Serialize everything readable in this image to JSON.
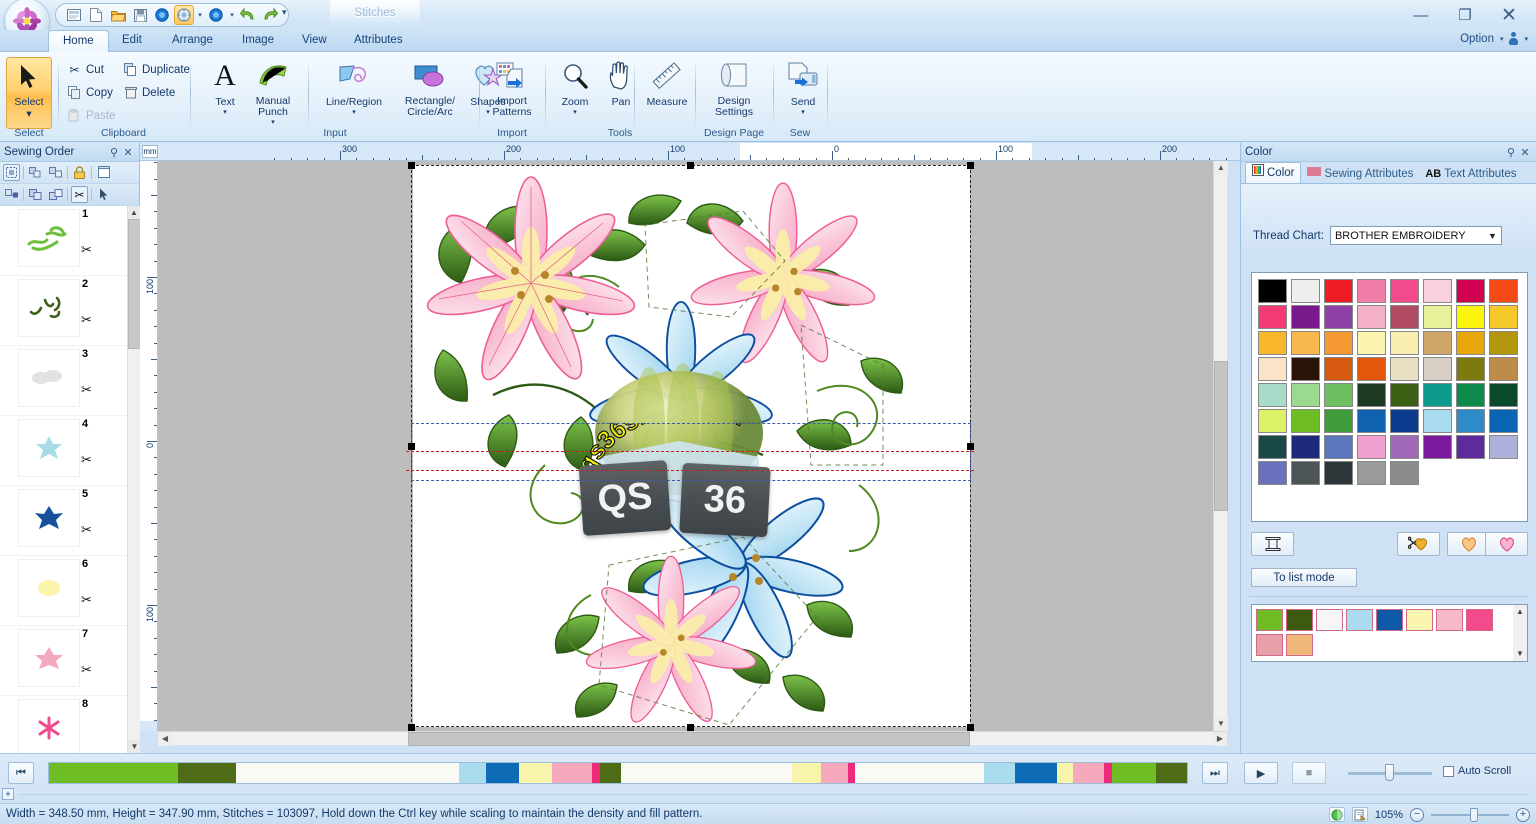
{
  "window": {
    "title": "",
    "document_tab": "Stitches",
    "minimize": "—",
    "restore": "❐",
    "close": "✕"
  },
  "quick_access": {
    "items": [
      {
        "name": "new-design-wizard",
        "glyph": "▤"
      },
      {
        "name": "new-file",
        "glyph": "⬜"
      },
      {
        "name": "open-file",
        "glyph": "📂"
      },
      {
        "name": "save-file",
        "glyph": "💾"
      },
      {
        "name": "blue-circle-tool",
        "glyph": "●"
      },
      {
        "name": "design-settings-tool",
        "glyph": "⚙"
      },
      {
        "name": "blue-circle-tool-2",
        "glyph": "●"
      },
      {
        "name": "undo",
        "glyph": "↶"
      },
      {
        "name": "redo",
        "glyph": "↷"
      }
    ],
    "more": "▾"
  },
  "ribbon": {
    "tabs": [
      {
        "label": "Home",
        "active": true
      },
      {
        "label": "Edit",
        "active": false
      },
      {
        "label": "Arrange",
        "active": false
      },
      {
        "label": "Image",
        "active": false
      },
      {
        "label": "View",
        "active": false
      },
      {
        "label": "Attributes",
        "active": false
      }
    ],
    "option_label": "Option",
    "groups": [
      {
        "name": "select",
        "label": "Select",
        "main_button": {
          "label": "Select",
          "icon": "cursor-arrow-icon"
        }
      },
      {
        "name": "clipboard",
        "label": "Clipboard",
        "buttons": [
          {
            "label": "Cut",
            "icon": "scissors-icon",
            "disabled": false
          },
          {
            "label": "Duplicate",
            "icon": "duplicate-icon",
            "disabled": false
          },
          {
            "label": "Copy",
            "icon": "copy-icon",
            "disabled": false
          },
          {
            "label": "Delete",
            "icon": "trash-icon",
            "disabled": false
          },
          {
            "label": "Paste",
            "icon": "paste-icon",
            "disabled": true
          }
        ]
      },
      {
        "name": "input",
        "label": "Input",
        "buttons": [
          {
            "label": "Text",
            "icon": "text-A-icon",
            "caret": true
          },
          {
            "label": "Manual Punch",
            "icon": "manual-punch-icon",
            "caret": true
          },
          {
            "label": "Line/Region",
            "icon": "line-region-icon",
            "caret": true
          },
          {
            "label": "Rectangle/ Circle/Arc",
            "icon": "shapes-rect-circle-icon",
            "caret": true
          },
          {
            "label": "Shapes",
            "icon": "heart-star-icon",
            "caret": true
          }
        ]
      },
      {
        "name": "import",
        "label": "Import",
        "buttons": [
          {
            "label": "Import Patterns",
            "icon": "import-patterns-icon",
            "caret": true
          }
        ]
      },
      {
        "name": "tools",
        "label": "Tools",
        "buttons": [
          {
            "label": "Zoom",
            "icon": "magnifier-icon",
            "caret": true
          },
          {
            "label": "Pan",
            "icon": "hand-icon",
            "caret": false
          },
          {
            "label": "Measure",
            "icon": "ruler-icon",
            "caret": false
          }
        ]
      },
      {
        "name": "design-page",
        "label": "Design Page",
        "buttons": [
          {
            "label": "Design Settings",
            "icon": "design-settings-icon",
            "caret": false
          }
        ]
      },
      {
        "name": "sew",
        "label": "Sew",
        "buttons": [
          {
            "label": "Send",
            "icon": "send-icon",
            "caret": true
          }
        ]
      }
    ]
  },
  "sewing_order": {
    "title": "Sewing Order",
    "pin": "⚓",
    "close": "✕",
    "toolbar_row1": [
      {
        "name": "select-all-objects-icon",
        "glyph": "⛶",
        "active": true
      },
      {
        "name": "group-objects-icon",
        "glyph": "❐"
      },
      {
        "name": "ungroup-objects-icon",
        "glyph": "❑"
      },
      {
        "name": "lock-icon",
        "glyph": "🔒"
      },
      {
        "name": "design-page-icon",
        "glyph": "▢"
      }
    ],
    "toolbar_row2": [
      {
        "name": "insert-object-icon",
        "glyph": "⊞"
      },
      {
        "name": "merge-objects-icon",
        "glyph": "⧉"
      },
      {
        "name": "split-objects-icon",
        "glyph": "❐"
      },
      {
        "name": "cut-thread-icon",
        "glyph": "✂",
        "active": true
      },
      {
        "name": "pointer-icon",
        "glyph": "➤"
      }
    ],
    "items": [
      {
        "number": "1",
        "color": "#6ec03c",
        "shape": "vine"
      },
      {
        "number": "2",
        "color": "#3e5f1b",
        "shape": "vine"
      },
      {
        "number": "3",
        "color": "#e2e2e2",
        "shape": "blob"
      },
      {
        "number": "4",
        "color": "#a8dbe8",
        "shape": "star"
      },
      {
        "number": "5",
        "color": "#17509b",
        "shape": "blob"
      },
      {
        "number": "6",
        "color": "#fbf6ae",
        "shape": "blob"
      },
      {
        "number": "7",
        "color": "#f5a8bd",
        "shape": "blob"
      },
      {
        "number": "8",
        "color": "#ef4c8f",
        "shape": "star"
      }
    ],
    "scissors_glyph": "✂"
  },
  "rulers": {
    "unit": "mm",
    "top_labels": [
      "300",
      "200",
      "100",
      "0",
      "100",
      "200",
      "300"
    ],
    "left_labels": [
      "100",
      "0",
      "100"
    ]
  },
  "canvas": {
    "watermark": {
      "arc_text": "qs36shop.com",
      "box_left": "QS",
      "box_right": "36",
      "arc_color": "#f2f20a",
      "arc_outline": "#1b1b1b"
    },
    "design_colors": {
      "pink_petal": "#f8b8cd",
      "pink_outline": "#ef5f97",
      "yellow_petal": "#fbf2a8",
      "blue_petal": "#bfe3f5",
      "blue_outline": "#0d4ea0",
      "leaf_green": "#3f7a22",
      "leaf_light": "#7cc24a",
      "stem_dark": "#2d5a14"
    }
  },
  "playback": {
    "first_button": "⏮",
    "last_button": "⏭",
    "play_button": "▶",
    "stop_button": "■",
    "expand_button": "+",
    "auto_scroll_label": "Auto Scroll",
    "auto_scroll_checked": false,
    "stitch_segments": [
      {
        "color": "#6fbd25",
        "width": 12.5
      },
      {
        "color": "#4e6b15",
        "width": 5.6
      },
      {
        "color": "#fafaf5",
        "width": 21.5
      },
      {
        "color": "#a9dced",
        "width": 2.6
      },
      {
        "color": "#0d6cb5",
        "width": 3.2
      },
      {
        "color": "#f9f4ac",
        "width": 3.2
      },
      {
        "color": "#f6a9bd",
        "width": 3.9
      },
      {
        "color": "#ee2a7b",
        "width": 0.8
      },
      {
        "color": "#4e6b15",
        "width": 2.0
      },
      {
        "color": "#fafaf5",
        "width": 16.5
      },
      {
        "color": "#f9f4ac",
        "width": 2.8
      },
      {
        "color": "#f6a9bd",
        "width": 2.6
      },
      {
        "color": "#ee2a7b",
        "width": 0.7
      },
      {
        "color": "#fafaf5",
        "width": 12.5
      },
      {
        "color": "#a9dced",
        "width": 3.0
      },
      {
        "color": "#0d6cb5",
        "width": 4.0
      },
      {
        "color": "#f9f4ac",
        "width": 1.6
      },
      {
        "color": "#f6a9bd",
        "width": 3.0
      },
      {
        "color": "#ee2a7b",
        "width": 0.7
      },
      {
        "color": "#6fbd25",
        "width": 4.3
      },
      {
        "color": "#4e6b15",
        "width": 3.0
      }
    ]
  },
  "status": {
    "message": "Width = 348.50 mm, Height = 347.90 mm, Stitches = 103097, Hold down the Ctrl key while scaling to maintain the density and fill pattern.",
    "zoom_level": "105%",
    "zoom_out": "−",
    "zoom_in": "+",
    "icons": [
      {
        "name": "realistic-view-icon",
        "glyph": "◐"
      },
      {
        "name": "print-preview-icon",
        "glyph": "🖶"
      }
    ]
  },
  "color_panel": {
    "title": "Color",
    "pin": "⚓",
    "close": "✕",
    "tabs": [
      {
        "label": "Color",
        "icon": "color-spool-icon",
        "active": true
      },
      {
        "label": "Sewing Attributes",
        "icon": "stitch-pattern-icon",
        "active": false
      },
      {
        "label": "Text Attributes",
        "icon": "AB",
        "active": false
      }
    ],
    "thread_chart_label": "Thread Chart:",
    "thread_chart_value": "BROTHER EMBROIDERY",
    "to_list_mode_label": "To list mode",
    "action_buttons": [
      {
        "name": "thread-spool-button",
        "glyph": "⧉"
      },
      {
        "name": "cut-favorite-button",
        "glyph": "✂"
      },
      {
        "name": "favorite-orange-button",
        "glyph": "♥"
      },
      {
        "name": "favorite-pink-button",
        "glyph": "♥"
      }
    ],
    "swatches": [
      "#000000",
      "#eeeeee",
      "#ed1c24",
      "#f07ca8",
      "#f24a8a",
      "#f9d1dd",
      "#d10050",
      "#f54a16",
      "#f53b74",
      "#7a1a8c",
      "#8e3fa8",
      "#f4b0c6",
      "#b04a62",
      "#e8f09a",
      "#fbf40f",
      "#f5c92a",
      "#f7b62c",
      "#f8b84e",
      "#f59a33",
      "#fbf5b0",
      "#f7eeb0",
      "#cfa56a",
      "#e8a70a",
      "#b2960d",
      "#fbe2c8",
      "#2a1408",
      "#d55a10",
      "#e2590b",
      "#e8e0c2",
      "#d8cfc6",
      "#7d7a10",
      "#bd8b4a",
      "#a8dcc8",
      "#9bd98e",
      "#6cc060",
      "#1e3a22",
      "#3c6014",
      "#0e9a8a",
      "#0e8a4a",
      "#0a4a2a",
      "#ddf266",
      "#6fbd25",
      "#3d9c37",
      "#0f63b0",
      "#0b3b8c",
      "#a8dcee",
      "#2e8bc8",
      "#0c64b4",
      "#1a4a48",
      "#1d2a7a",
      "#5a76bd",
      "#f0a0ce",
      "#a06ab8",
      "#7b1a9c",
      "#5e2a9c",
      "#aeb0dc",
      "#6a72c0",
      "#4c5456",
      "#2c3638",
      "#9a9a9a",
      "#8c8c8c"
    ],
    "used_colors_row1": [
      "#6fbd25",
      "#3c5a10",
      "#f6f6f6",
      "#a8dcee",
      "#0f5aa8",
      "#fbf5b0",
      "#f6b9c8",
      "#f24a8a"
    ],
    "used_colors_row2": [
      "#e8a0a8",
      "#f0b878"
    ]
  }
}
